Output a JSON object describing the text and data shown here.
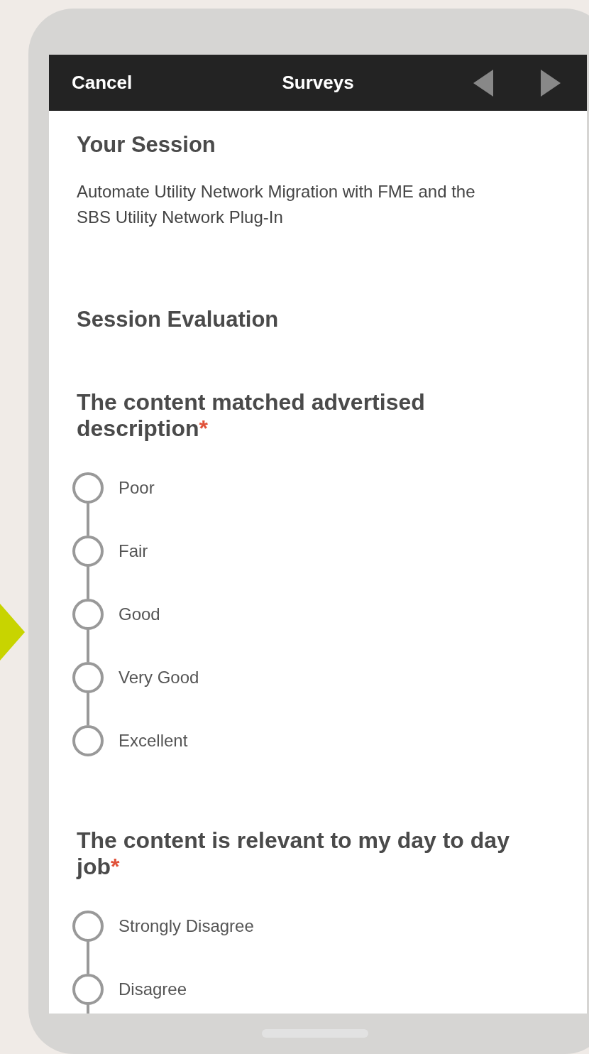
{
  "header": {
    "cancel": "Cancel",
    "title": "Surveys"
  },
  "your_session": {
    "heading": "Your Session",
    "description": "Automate Utility Network Migration with FME and the SBS Utility Network Plug-In"
  },
  "section_heading": "Session Evaluation",
  "questions": [
    {
      "text": "The content matched advertised description",
      "required_mark": "*",
      "more_below": false,
      "options": [
        {
          "label": "Poor",
          "selected": false
        },
        {
          "label": "Fair",
          "selected": false
        },
        {
          "label": "Good",
          "selected": false
        },
        {
          "label": "Very Good",
          "selected": false
        },
        {
          "label": "Excellent",
          "selected": false
        }
      ]
    },
    {
      "text": "The content is relevant to my day to day job",
      "required_mark": "*",
      "more_below": true,
      "options": [
        {
          "label": "Strongly Disagree",
          "selected": false
        },
        {
          "label": "Disagree",
          "selected": false
        }
      ]
    }
  ]
}
